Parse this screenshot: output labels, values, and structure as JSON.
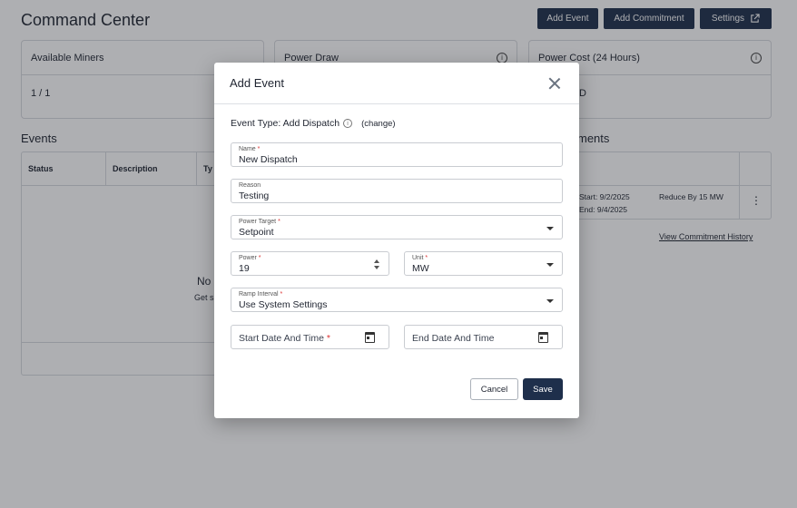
{
  "page": {
    "title": "Command Center",
    "header_buttons": {
      "add_event": "Add Event",
      "add_commitment": "Add Commitment",
      "settings": "Settings"
    },
    "cards": [
      {
        "label": "Available Miners",
        "value": "1 / 1"
      },
      {
        "label": "Power Draw",
        "value": ""
      },
      {
        "label": "Power Cost (24 Hours)",
        "value": "D"
      }
    ],
    "events": {
      "title": "Events",
      "columns": [
        "Status",
        "Description",
        "Ty"
      ],
      "empty_title": "No",
      "empty_sub": "Get s"
    },
    "commitments": {
      "title": "ments",
      "row": {
        "start": "Start: 9/2/2025",
        "end": "End: 9/4/2025",
        "action": "Reduce By 15 MW",
        "menu": "⋮"
      },
      "history_link": "View Commitment History"
    }
  },
  "modal": {
    "title": "Add Event",
    "event_type": "Event Type: Add Dispatch",
    "change_link": "(change)",
    "fields": {
      "name": {
        "label": "Name",
        "required": "*",
        "value": "New Dispatch"
      },
      "reason": {
        "label": "Reason",
        "value": "Testing"
      },
      "power_target": {
        "label": "Power Target",
        "required": "*",
        "value": "Setpoint"
      },
      "power": {
        "label": "Power",
        "required": "*",
        "value": "19"
      },
      "unit": {
        "label": "Unit",
        "required": "*",
        "value": "MW"
      },
      "ramp_interval": {
        "label": "Ramp Interval",
        "required": "*",
        "value": "Use System Settings"
      },
      "start": {
        "placeholder": "Start Date And Time",
        "required": "*"
      },
      "end": {
        "placeholder": "End Date And Time"
      }
    },
    "cancel_label": "Cancel",
    "save_label": "Save"
  },
  "colors": {
    "primary": "#1e2f4b",
    "required": "#d33333",
    "border": "#c9ccd1"
  },
  "icons": [
    "info-icon",
    "external-link-icon",
    "close-icon",
    "chevron-down-icon",
    "calendar-icon",
    "spinner-arrows-icon",
    "kebab-menu-icon"
  ]
}
